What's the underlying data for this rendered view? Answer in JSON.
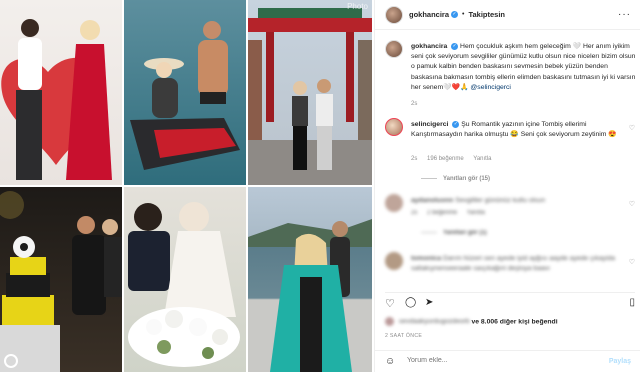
{
  "post": {
    "username": "gokhancira",
    "follow_label": "Takiptesin",
    "caption_user": "gokhancira",
    "caption_text": "Hem çocukluk aşkım hem geleceğim 🤍 Her anım iyikim seni çok seviyorum sevgililer günümüz kutlu olsun nice nicelerı bizim olsun o pamuk kalbin benden baskasını sevmesin bebek yüzün benden baskasına bakmasın tombiş ellerin elimden baskasını tutmasın iyi ki varsın her senem🤍❤️🙏",
    "caption_mention": "@selincigerci",
    "caption_age": "2s"
  },
  "comments": [
    {
      "user": "selincigerci",
      "text": "Şu Romantik yazının içine Tombiş ellerimi Karıştırmasaydın harika olmuştu 😂 Seni çok seviyorum zeytinim 😍",
      "age": "2s",
      "likes": "196 beğenme",
      "reply": "Yanıtla",
      "replies_label": "Yanıtları gör (15)"
    },
    {
      "user": "aydanoluonn",
      "text": "Sevgililer gününüz kutlu olsun",
      "age": "2s",
      "likes": "2 beğenme",
      "reply": "Yanıtla",
      "replies_label": "Yanıtları gör (1)"
    },
    {
      "user": "tomonica",
      "text": "Darım hüzeri sen ayede iyid ayğısı aayde ayede çıkayida saltakıynenseeraale saıçıkağıni deştoya baavı",
      "age": "2s",
      "likes": "1 beğenme",
      "reply": "Yanıtla",
      "replies_label": ""
    }
  ],
  "likes": {
    "liker": "sevdaakyurdugozdeorb",
    "rest": "ve 8.006 diğer kişi beğendi"
  },
  "time_label": "2 SAAT ÖNCE",
  "add_comment": {
    "placeholder": "Yorum ekle...",
    "post_label": "Paylaş"
  },
  "watermark": "Photo",
  "colors": {
    "link": "#00376b",
    "muted": "#8e8e8e",
    "accent": "#3897f0",
    "post_disabled": "#b2dffc"
  }
}
